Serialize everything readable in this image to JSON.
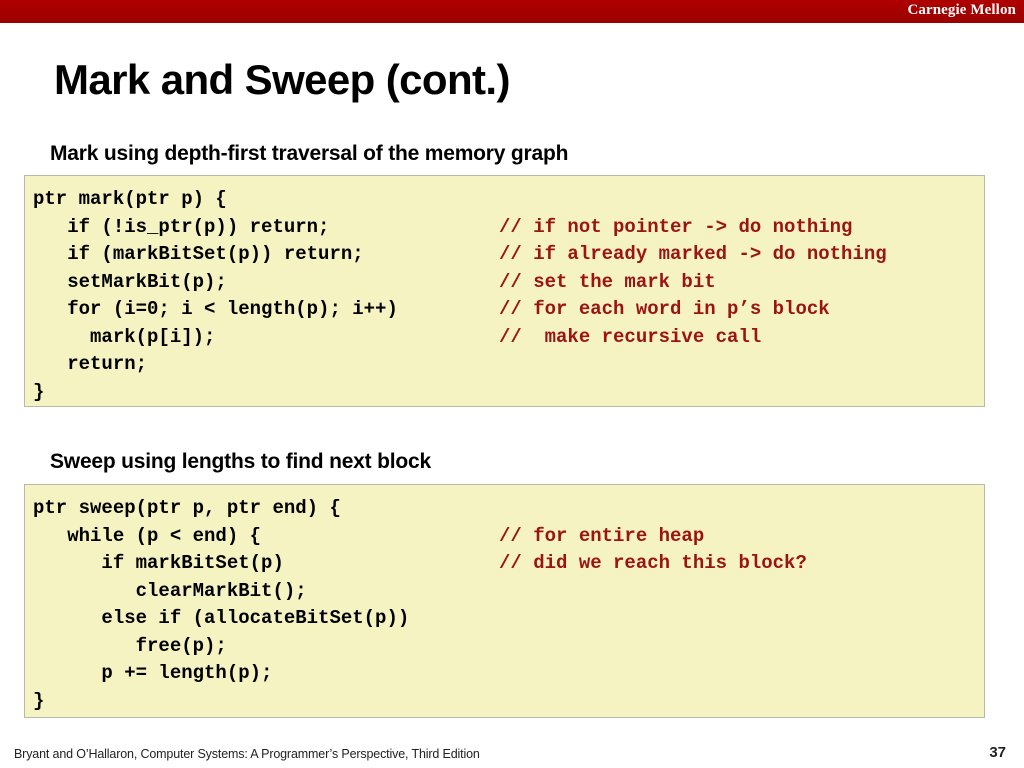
{
  "brand": {
    "name": "Carnegie Mellon",
    "band_color": "#a90000"
  },
  "slide": {
    "title": "Mark and Sweep (cont.)",
    "page_number": "37"
  },
  "sections": [
    {
      "heading": "Mark using depth-first traversal of the memory graph",
      "code_block_name": "mark-code",
      "lines": [
        {
          "code": "ptr mark(ptr p) {",
          "comment": ""
        },
        {
          "code": "   if (!is_ptr(p)) return;",
          "comment": "// if not pointer -> do nothing"
        },
        {
          "code": "   if (markBitSet(p)) return;",
          "comment": "// if already marked -> do nothing"
        },
        {
          "code": "   setMarkBit(p);",
          "comment": "// set the mark bit"
        },
        {
          "code": "   for (i=0; i < length(p); i++)",
          "comment": "// for each word in p’s block"
        },
        {
          "code": "     mark(p[i]);",
          "comment": "//  make recursive call"
        },
        {
          "code": "   return;",
          "comment": ""
        },
        {
          "code": "}",
          "comment": ""
        }
      ]
    },
    {
      "heading": "Sweep using lengths to find next block",
      "code_block_name": "sweep-code",
      "lines": [
        {
          "code": "ptr sweep(ptr p, ptr end) {",
          "comment": ""
        },
        {
          "code": "   while (p < end) {",
          "comment": "// for entire heap"
        },
        {
          "code": "      if markBitSet(p)",
          "comment": "// did we reach this block?"
        },
        {
          "code": "         clearMarkBit();",
          "comment": ""
        },
        {
          "code": "      else if (allocateBitSet(p))",
          "comment": ""
        },
        {
          "code": "         free(p);",
          "comment": ""
        },
        {
          "code": "      p += length(p);",
          "comment": ""
        },
        {
          "code": "}",
          "comment": ""
        }
      ]
    }
  ],
  "footer": {
    "citation": "Bryant and O’Hallaron, Computer Systems: A Programmer’s Perspective, Third Edition"
  },
  "colors": {
    "brand_red": "#a90000",
    "code_background": "#f6f3c2",
    "code_border": "#b9b9a8",
    "comment_red": "#9b1313",
    "text_black": "#000000"
  }
}
